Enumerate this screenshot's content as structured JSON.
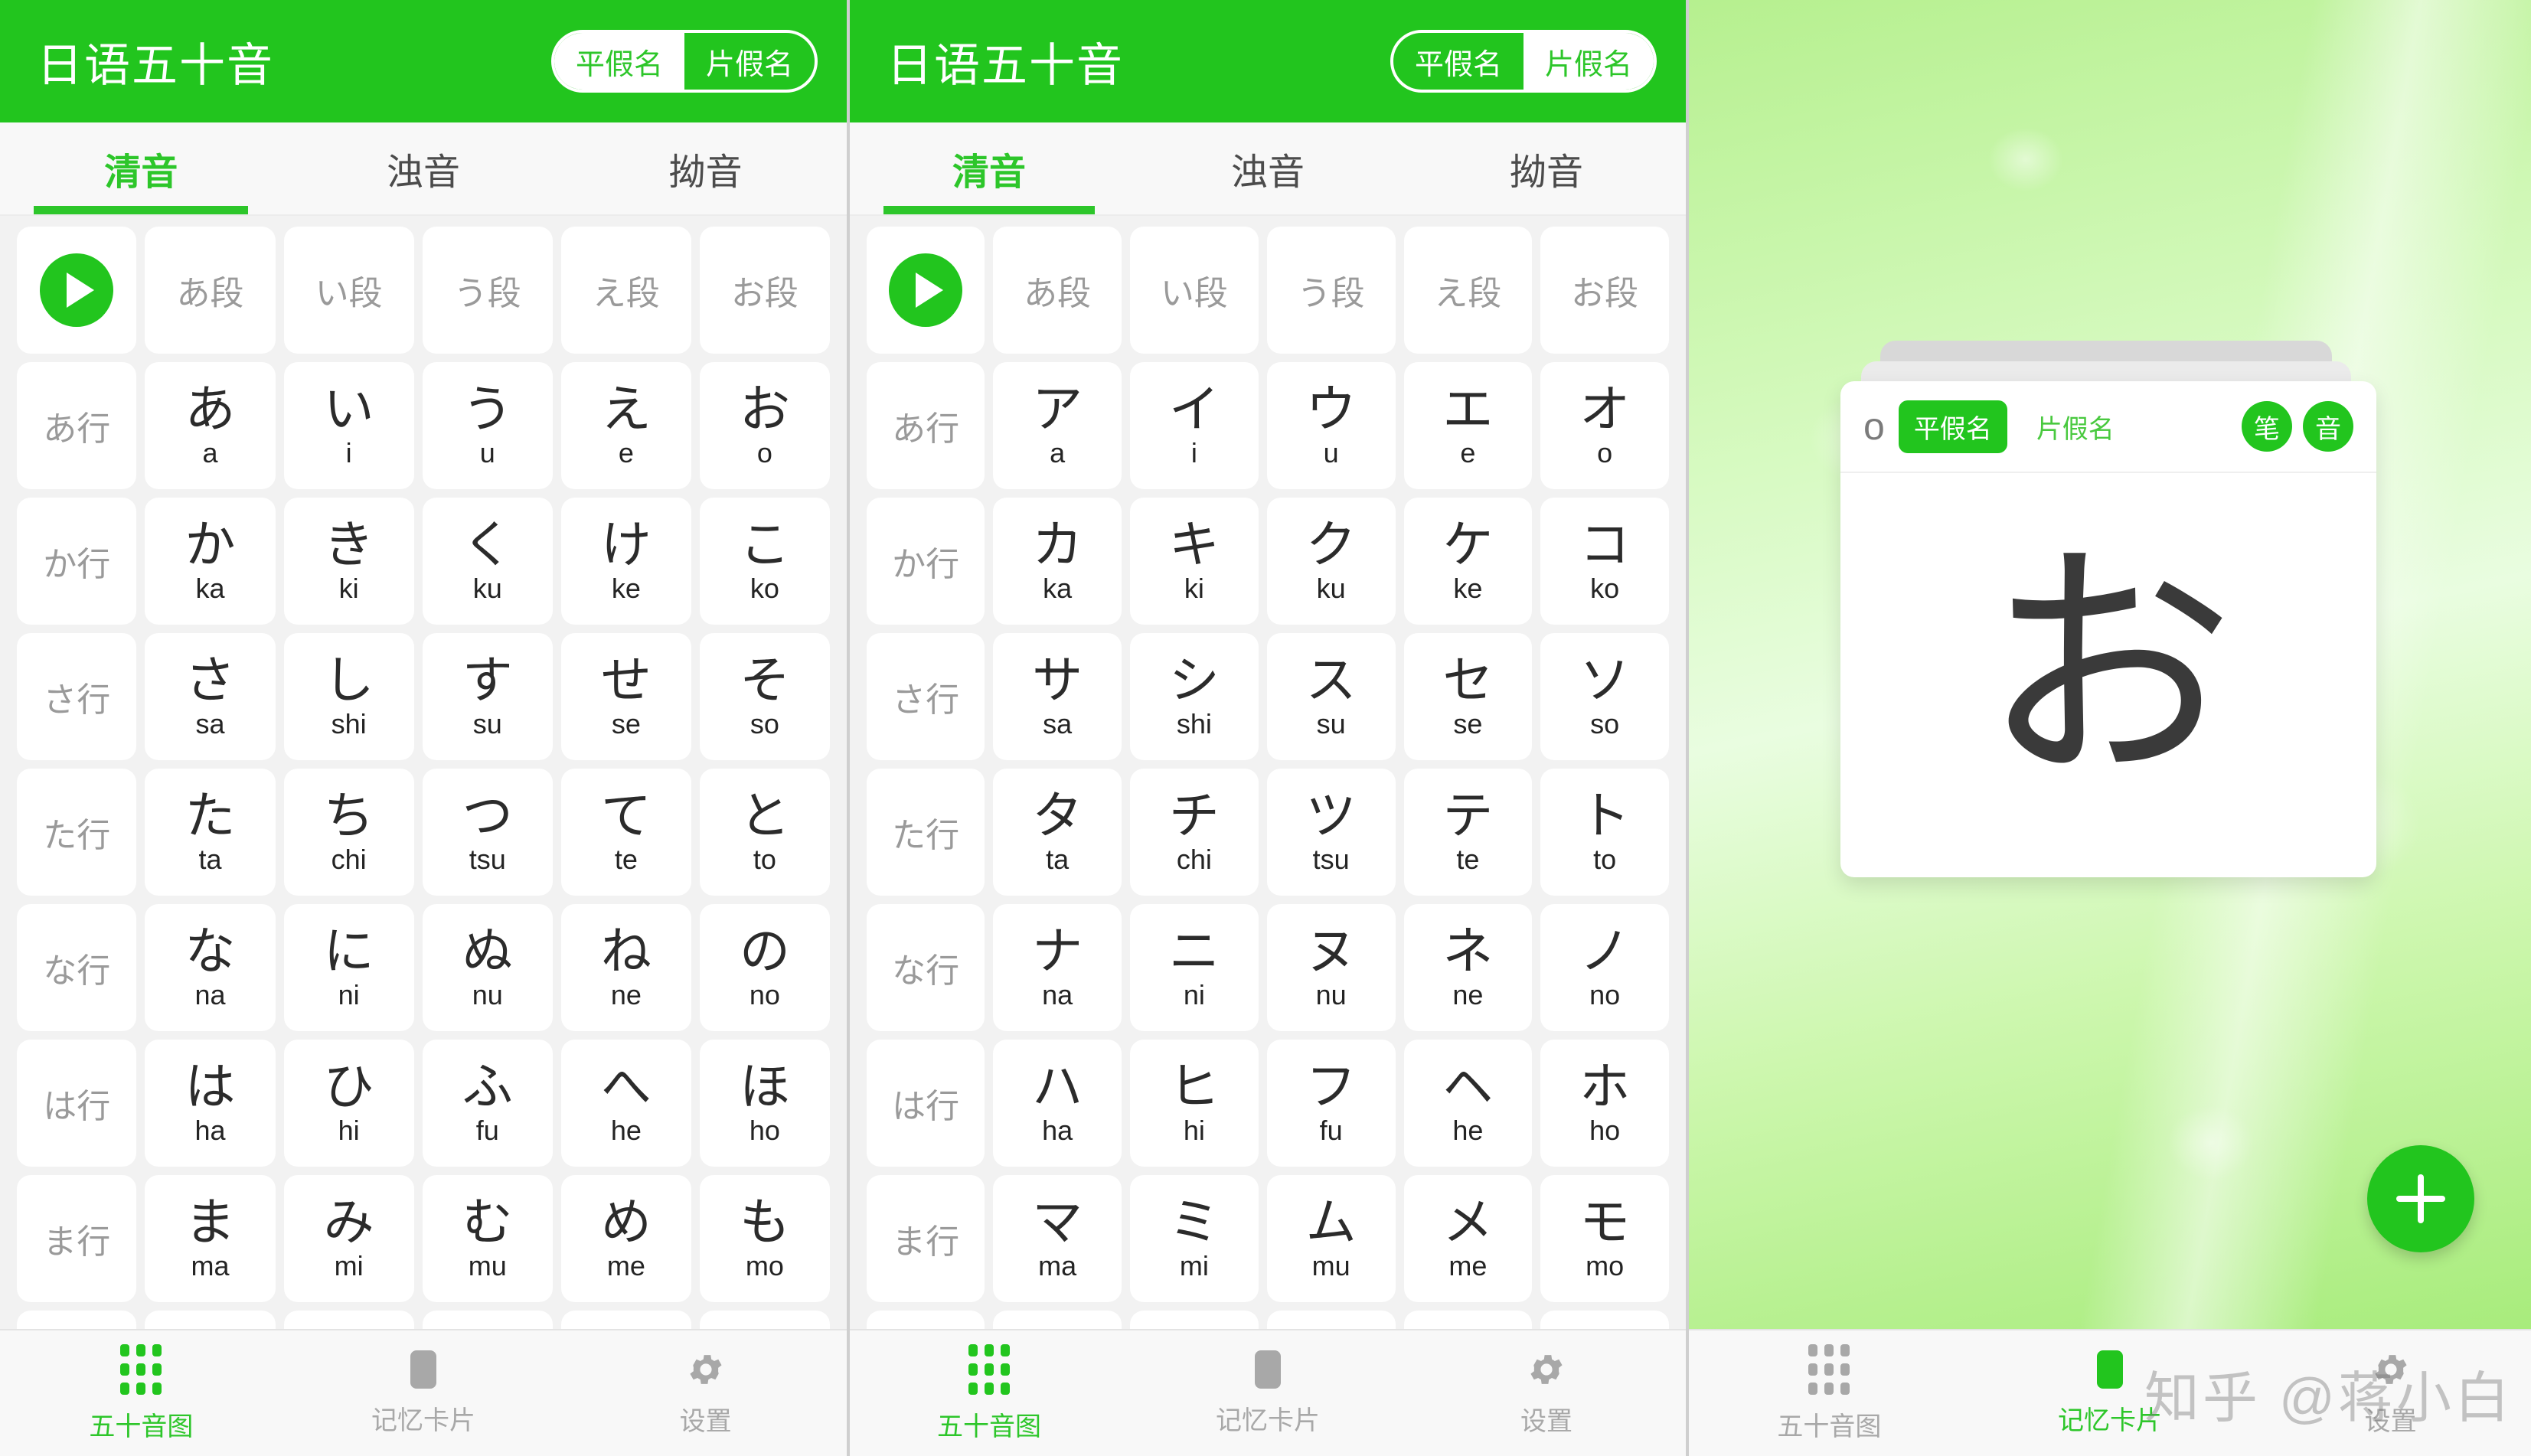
{
  "app": {
    "title": "日语五十音",
    "kana_toggle": {
      "hiragana": "平假名",
      "katakana": "片假名"
    },
    "tabs": [
      {
        "label": "清音"
      },
      {
        "label": "浊音"
      },
      {
        "label": "拗音"
      }
    ],
    "bottom_nav": [
      {
        "label": "五十音图",
        "icon": "grid-icon"
      },
      {
        "label": "记忆卡片",
        "icon": "card-icon"
      },
      {
        "label": "设置",
        "icon": "gear-icon"
      }
    ],
    "column_headers": [
      "あ段",
      "い段",
      "う段",
      "え段",
      "お段"
    ],
    "row_headers": [
      "あ行",
      "か行",
      "さ行",
      "た行",
      "な行",
      "は行",
      "ま行"
    ],
    "play_icon": "play-icon"
  },
  "panel1": {
    "selected_kana": "平假名",
    "active_tab": "清音",
    "active_nav": "五十音图",
    "rows": [
      {
        "header": "あ行",
        "cells": [
          {
            "kana": "あ",
            "romaji": "a"
          },
          {
            "kana": "い",
            "romaji": "i"
          },
          {
            "kana": "う",
            "romaji": "u"
          },
          {
            "kana": "え",
            "romaji": "e"
          },
          {
            "kana": "お",
            "romaji": "o"
          }
        ]
      },
      {
        "header": "か行",
        "cells": [
          {
            "kana": "か",
            "romaji": "ka"
          },
          {
            "kana": "き",
            "romaji": "ki"
          },
          {
            "kana": "く",
            "romaji": "ku"
          },
          {
            "kana": "け",
            "romaji": "ke"
          },
          {
            "kana": "こ",
            "romaji": "ko"
          }
        ]
      },
      {
        "header": "さ行",
        "cells": [
          {
            "kana": "さ",
            "romaji": "sa"
          },
          {
            "kana": "し",
            "romaji": "shi"
          },
          {
            "kana": "す",
            "romaji": "su"
          },
          {
            "kana": "せ",
            "romaji": "se"
          },
          {
            "kana": "そ",
            "romaji": "so"
          }
        ]
      },
      {
        "header": "た行",
        "cells": [
          {
            "kana": "た",
            "romaji": "ta"
          },
          {
            "kana": "ち",
            "romaji": "chi"
          },
          {
            "kana": "つ",
            "romaji": "tsu"
          },
          {
            "kana": "て",
            "romaji": "te"
          },
          {
            "kana": "と",
            "romaji": "to"
          }
        ]
      },
      {
        "header": "な行",
        "cells": [
          {
            "kana": "な",
            "romaji": "na"
          },
          {
            "kana": "に",
            "romaji": "ni"
          },
          {
            "kana": "ぬ",
            "romaji": "nu"
          },
          {
            "kana": "ね",
            "romaji": "ne"
          },
          {
            "kana": "の",
            "romaji": "no"
          }
        ]
      },
      {
        "header": "は行",
        "cells": [
          {
            "kana": "は",
            "romaji": "ha"
          },
          {
            "kana": "ひ",
            "romaji": "hi"
          },
          {
            "kana": "ふ",
            "romaji": "fu"
          },
          {
            "kana": "へ",
            "romaji": "he"
          },
          {
            "kana": "ほ",
            "romaji": "ho"
          }
        ]
      },
      {
        "header": "ま行",
        "cells": [
          {
            "kana": "ま",
            "romaji": "ma"
          },
          {
            "kana": "み",
            "romaji": "mi"
          },
          {
            "kana": "む",
            "romaji": "mu"
          },
          {
            "kana": "め",
            "romaji": "me"
          },
          {
            "kana": "も",
            "romaji": "mo"
          }
        ]
      }
    ]
  },
  "panel2": {
    "selected_kana": "片假名",
    "active_tab": "清音",
    "active_nav": "五十音图",
    "rows": [
      {
        "header": "あ行",
        "cells": [
          {
            "kana": "ア",
            "romaji": "a"
          },
          {
            "kana": "イ",
            "romaji": "i"
          },
          {
            "kana": "ウ",
            "romaji": "u"
          },
          {
            "kana": "エ",
            "romaji": "e"
          },
          {
            "kana": "オ",
            "romaji": "o"
          }
        ]
      },
      {
        "header": "か行",
        "cells": [
          {
            "kana": "カ",
            "romaji": "ka"
          },
          {
            "kana": "キ",
            "romaji": "ki"
          },
          {
            "kana": "ク",
            "romaji": "ku"
          },
          {
            "kana": "ケ",
            "romaji": "ke"
          },
          {
            "kana": "コ",
            "romaji": "ko"
          }
        ]
      },
      {
        "header": "さ行",
        "cells": [
          {
            "kana": "サ",
            "romaji": "sa"
          },
          {
            "kana": "シ",
            "romaji": "shi"
          },
          {
            "kana": "ス",
            "romaji": "su"
          },
          {
            "kana": "セ",
            "romaji": "se"
          },
          {
            "kana": "ソ",
            "romaji": "so"
          }
        ]
      },
      {
        "header": "た行",
        "cells": [
          {
            "kana": "タ",
            "romaji": "ta"
          },
          {
            "kana": "チ",
            "romaji": "chi"
          },
          {
            "kana": "ツ",
            "romaji": "tsu"
          },
          {
            "kana": "テ",
            "romaji": "te"
          },
          {
            "kana": "ト",
            "romaji": "to"
          }
        ]
      },
      {
        "header": "な行",
        "cells": [
          {
            "kana": "ナ",
            "romaji": "na"
          },
          {
            "kana": "ニ",
            "romaji": "ni"
          },
          {
            "kana": "ヌ",
            "romaji": "nu"
          },
          {
            "kana": "ネ",
            "romaji": "ne"
          },
          {
            "kana": "ノ",
            "romaji": "no"
          }
        ]
      },
      {
        "header": "は行",
        "cells": [
          {
            "kana": "ハ",
            "romaji": "ha"
          },
          {
            "kana": "ヒ",
            "romaji": "hi"
          },
          {
            "kana": "フ",
            "romaji": "fu"
          },
          {
            "kana": "ヘ",
            "romaji": "he"
          },
          {
            "kana": "ホ",
            "romaji": "ho"
          }
        ]
      },
      {
        "header": "ま行",
        "cells": [
          {
            "kana": "マ",
            "romaji": "ma"
          },
          {
            "kana": "ミ",
            "romaji": "mi"
          },
          {
            "kana": "ム",
            "romaji": "mu"
          },
          {
            "kana": "メ",
            "romaji": "me"
          },
          {
            "kana": "モ",
            "romaji": "mo"
          }
        ]
      }
    ]
  },
  "panel3": {
    "active_nav": "记忆卡片",
    "card": {
      "romaji": "o",
      "kana": "お",
      "hiragana_label": "平假名",
      "katakana_label": "片假名",
      "selected": "平假名",
      "stroke_button": "笔",
      "audio_button": "音"
    },
    "add_button": "+",
    "watermark": "知乎 @蒋小白"
  },
  "colors": {
    "brand_green": "#22c51e",
    "accent_green": "#2dc62a",
    "inactive_gray": "#a8a8a8",
    "card_bg": "#ffffff",
    "page_bg": "#f2f2f2"
  }
}
